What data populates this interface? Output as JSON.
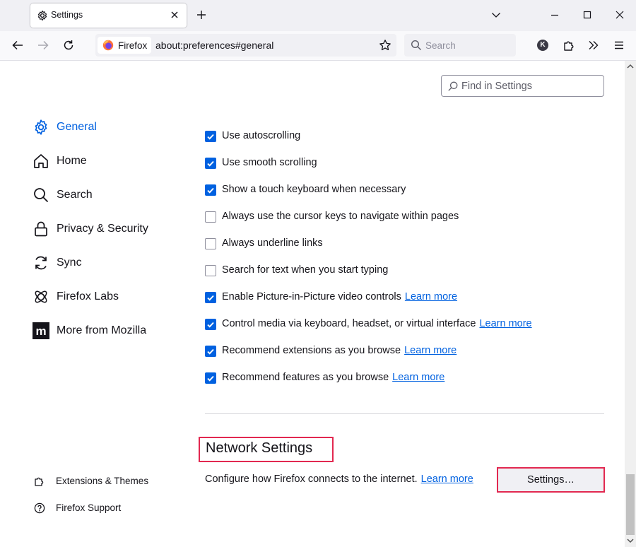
{
  "tab": {
    "title": "Settings"
  },
  "urlbar": {
    "identity": "Firefox",
    "url": "about:preferences#general"
  },
  "searchbar": {
    "placeholder": "Search"
  },
  "account": {
    "initial": "K"
  },
  "find": {
    "placeholder": "Find in Settings"
  },
  "sidebar": {
    "categories": [
      {
        "label": "General",
        "icon": "gear-icon",
        "selected": true
      },
      {
        "label": "Home",
        "icon": "home-icon"
      },
      {
        "label": "Search",
        "icon": "search-icon"
      },
      {
        "label": "Privacy & Security",
        "icon": "lock-icon"
      },
      {
        "label": "Sync",
        "icon": "sync-icon"
      },
      {
        "label": "Firefox Labs",
        "icon": "labs-icon"
      },
      {
        "label": "More from Mozilla",
        "icon": "mozilla-icon"
      }
    ],
    "footer": [
      {
        "label": "Extensions & Themes",
        "icon": "puzzle-icon"
      },
      {
        "label": "Firefox Support",
        "icon": "help-icon"
      }
    ]
  },
  "browsing": {
    "options": [
      {
        "label": "Use autoscrolling",
        "checked": true
      },
      {
        "label": "Use smooth scrolling",
        "checked": true
      },
      {
        "label": "Show a touch keyboard when necessary",
        "checked": true
      },
      {
        "label": "Always use the cursor keys to navigate within pages",
        "checked": false
      },
      {
        "label": "Always underline links",
        "checked": false
      },
      {
        "label": "Search for text when you start typing",
        "checked": false
      },
      {
        "label": "Enable Picture-in-Picture video controls",
        "checked": true,
        "link": "Learn more"
      },
      {
        "label": "Control media via keyboard, headset, or virtual interface",
        "checked": true,
        "link": "Learn more"
      },
      {
        "label": "Recommend extensions as you browse",
        "checked": true,
        "link": "Learn more"
      },
      {
        "label": "Recommend features as you browse",
        "checked": true,
        "link": "Learn more"
      }
    ]
  },
  "network": {
    "title": "Network Settings",
    "description": "Configure how Firefox connects to the internet.",
    "link": "Learn more",
    "button": "Settings…"
  },
  "colors": {
    "accent": "#0061e0",
    "highlight": "#e22850"
  }
}
